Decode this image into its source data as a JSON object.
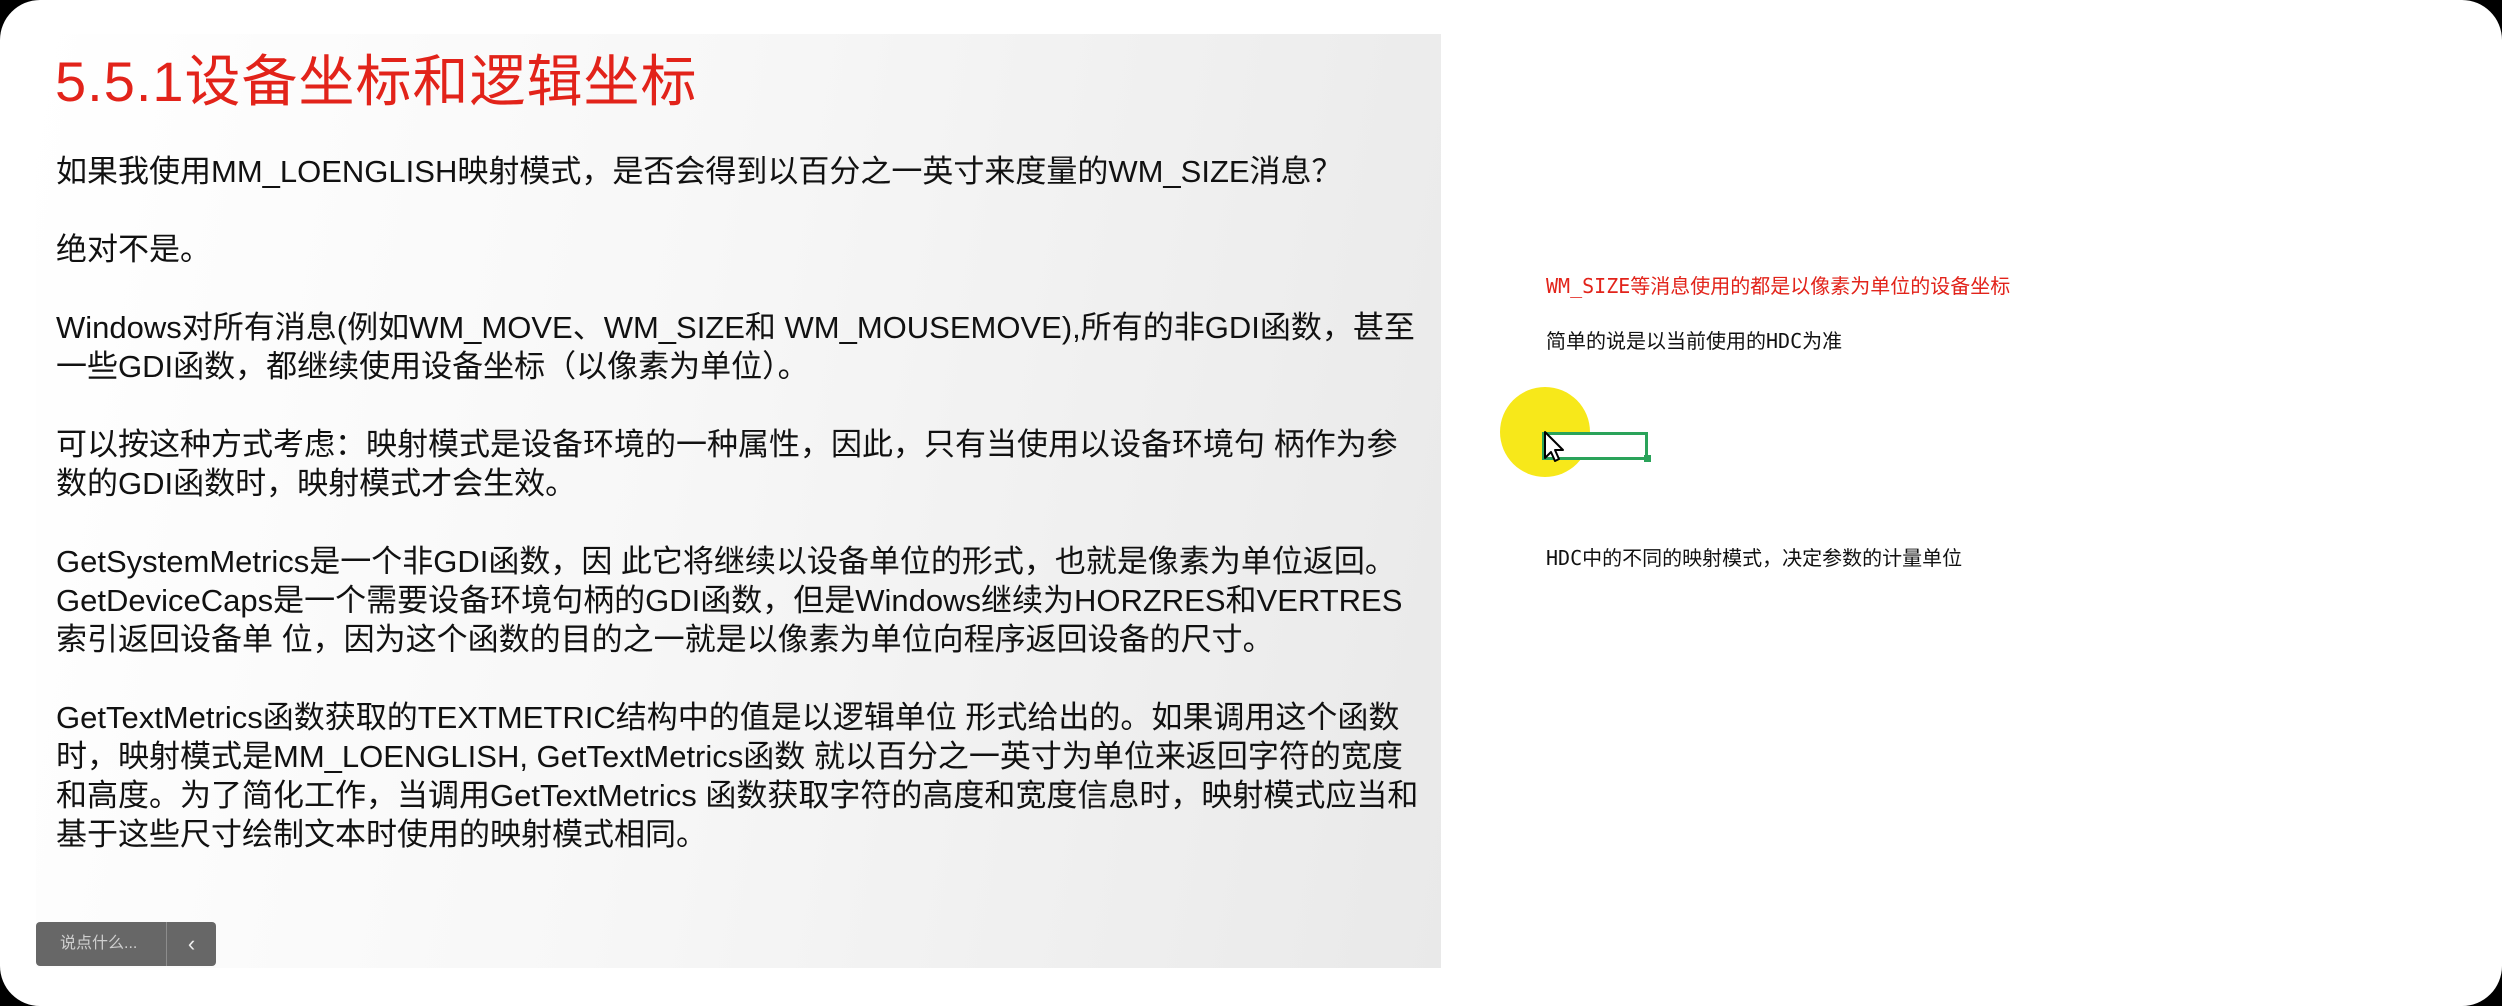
{
  "slide": {
    "title": "5.5.1设备坐标和逻辑坐标",
    "paragraphs": [
      "如果我使用MM_LOENGLISH映射模式，是否会得到以百分之一英寸来度量的WM_SIZE消息？",
      "绝对不是。",
      "Windows对所有消息(例如WM_MOVE、WM_SIZE和 WM_MOUSEMOVE),所有的非GDI函数，甚至一些GDI函数，都继续使用设备坐标（以像素为单位）。",
      "可以按这种方式考虑：映射模式是设备环境的一种属性，因此，只有当使用以设备环境句 柄作为参数的GDI函数时，映射模式才会生效。",
      "GetSystemMetrics是一个非GDI函数，因 此它将继续以设备单位的形式，也就是像素为单位返回。",
      "GetDeviceCaps是一个需要设备环境句柄的GDI函数，但是Windows继续为HORZRES和VERTRES索引返回设备单 位，因为这个函数的目的之一就是以像素为单位向程序返回设备的尺寸。",
      "GetTextMetrics函数获取的TEXTMETRIC结构中的值是以逻辑单位 形式给出的。如果调用这个函数时，映射模式是MM_LOENGLISH, GetTextMetrics函数 就以百分之一英寸为单位来返回字符的宽度和高度。为了简化工作，当调用GetTextMetrics 函数获取字符的高度和宽度信息时，映射模式应当和基于这些尺寸绘制文本时使用的映射模式相同。"
    ]
  },
  "comment_bar": {
    "placeholder": "说点什么...",
    "collapse_icon": "chevron-left-icon"
  },
  "notes": {
    "note1": "WM_SIZE等消息使用的都是以像素为单位的设备坐标",
    "note2": "简单的说是以当前使用的HDC为准",
    "note3": "HDC中的不同的映射模式，决定参数的计量单位"
  },
  "colors": {
    "title_red": "#e2231a",
    "highlight_yellow": "#f7e81a",
    "rect_green": "#2aa35a"
  }
}
